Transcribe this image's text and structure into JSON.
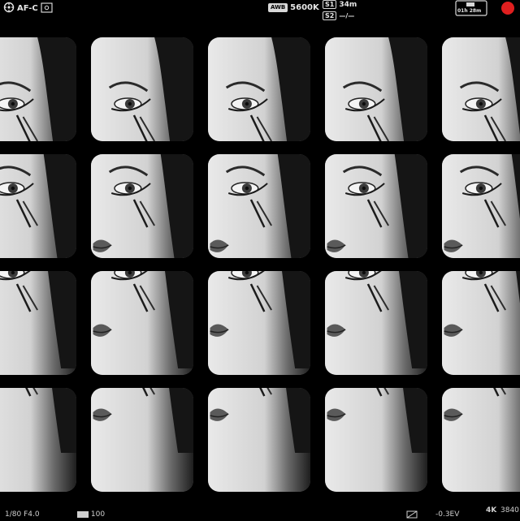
{
  "hud_top": {
    "focus_mode": "AF-C",
    "wb_badge": "AWB",
    "white_balance": "5600K",
    "slot1_label": "S1",
    "slot1_time": "34m",
    "slot2_label": "S2",
    "slot2_status": "—/—",
    "record_time": "01h 28m",
    "record_color": "#e01f1f",
    "icons": [
      "stabilizer-icon",
      "af-area-icon",
      "slot-1-icon",
      "slot-2-icon",
      "battery-icon",
      "record-indicator-icon"
    ]
  },
  "hud_bottom": {
    "left_text": "1/80  F4.0",
    "iso_text": "100",
    "ev_text": "-0.3EV",
    "format_line1": "4K",
    "format_line2": "3840"
  },
  "tiles": {
    "rows": 4,
    "cols": 5,
    "content": "repeated grayscale portrait frames (eye, cheek, lips)"
  }
}
